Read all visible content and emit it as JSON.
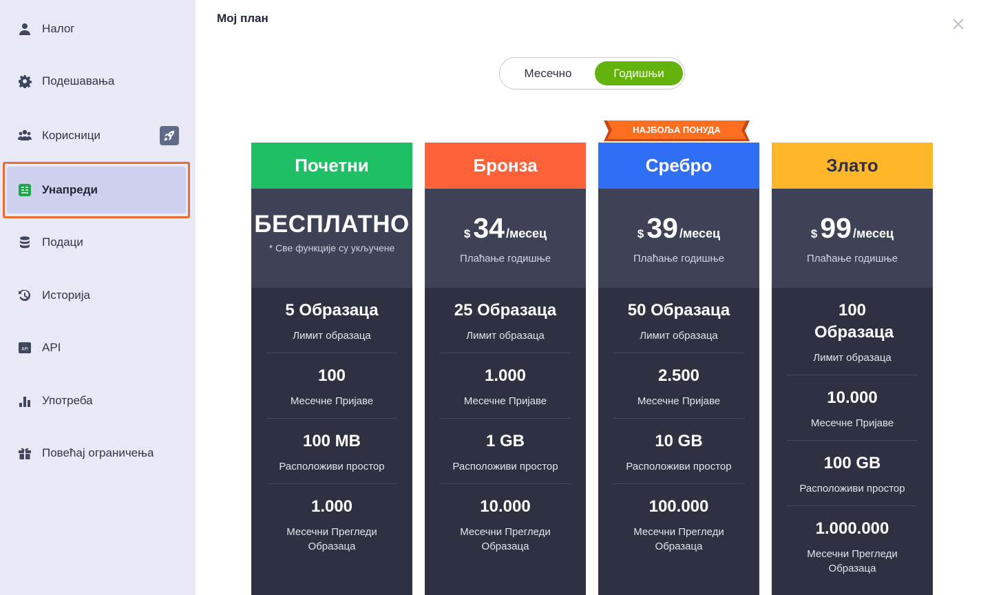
{
  "sidebar": {
    "items": [
      {
        "label": "Налог",
        "icon": "user-icon"
      },
      {
        "label": "Подешавања",
        "icon": "gear-icon"
      },
      {
        "label": "Корисници",
        "icon": "users-icon"
      },
      {
        "label": "Унапреди",
        "icon": "upgrade-icon"
      },
      {
        "label": "Подаци",
        "icon": "database-icon"
      },
      {
        "label": "Историја",
        "icon": "history-icon"
      },
      {
        "label": "API",
        "icon": "api-icon"
      },
      {
        "label": "Употреба",
        "icon": "bar-chart-icon"
      },
      {
        "label": "Повећај ограничења",
        "icon": "gift-icon"
      }
    ],
    "active_item": "Унапреди"
  },
  "main": {
    "title": "Мој план",
    "billing_toggle": {
      "monthly": "Месечно",
      "yearly": "Годишњи",
      "selected": "yearly"
    },
    "ribbon": "НАЈБОЉА ПОНУДА",
    "plans": [
      {
        "name": "Почетни",
        "color": "#1fbf65",
        "free_text": "БЕСПЛАТНО",
        "free_note": "* Све функције су укључене",
        "features": [
          {
            "value": "5 Образаца",
            "label": "Лимит образаца"
          },
          {
            "value": "100",
            "label": "Месечне Пријаве"
          },
          {
            "value": "100 MB",
            "label": "Расположиви простор"
          },
          {
            "value": "1.000",
            "label": "Месечни Прегледи Образаца"
          }
        ]
      },
      {
        "name": "Бронза",
        "color": "#ff6138",
        "currency": "$",
        "price": "34",
        "per": "/месец",
        "note": "Плаћање годишње",
        "features": [
          {
            "value": "25 Образаца",
            "label": "Лимит образаца"
          },
          {
            "value": "1.000",
            "label": "Месечне Пријаве"
          },
          {
            "value": "1 GB",
            "label": "Расположиви простор"
          },
          {
            "value": "10.000",
            "label": "Месечни Прегледи Образаца"
          }
        ]
      },
      {
        "name": "Сребро",
        "color": "#2e6ff5",
        "currency": "$",
        "price": "39",
        "per": "/месец",
        "note": "Плаћање годишње",
        "features": [
          {
            "value": "50 Образаца",
            "label": "Лимит образаца"
          },
          {
            "value": "2.500",
            "label": "Месечне Пријаве"
          },
          {
            "value": "10 GB",
            "label": "Расположиви простор"
          },
          {
            "value": "100.000",
            "label": "Месечни Прегледи Образаца"
          }
        ]
      },
      {
        "name": "Злато",
        "color": "#ffb629",
        "currency": "$",
        "price": "99",
        "per": "/месец",
        "note": "Плаћање годишње",
        "features": [
          {
            "value": "100 Образаца",
            "label": "Лимит образаца"
          },
          {
            "value": "10.000",
            "label": "Месечне Пријаве"
          },
          {
            "value": "100 GB",
            "label": "Расположиви простор"
          },
          {
            "value": "1.000.000",
            "label": "Месечни Прегледи Образаца"
          }
        ]
      }
    ]
  },
  "colors": {
    "toggle_active": "#64b20c",
    "active_frame": "#e96a33",
    "ribbon": "#ff6e1f"
  }
}
